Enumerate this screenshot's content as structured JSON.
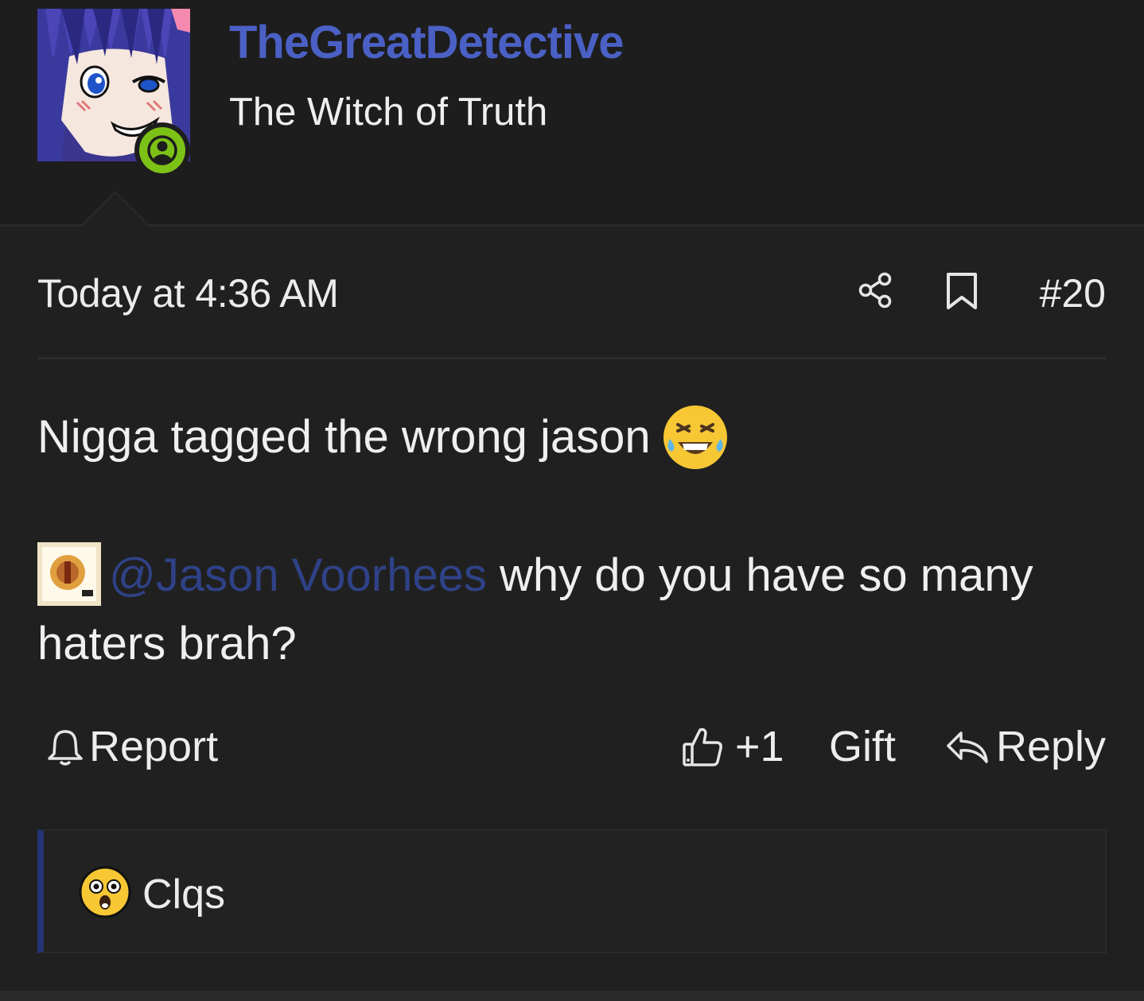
{
  "post": {
    "author": {
      "username": "TheGreatDetective",
      "title": "The Witch of Truth",
      "avatar_icon": "anime-avatar",
      "status_icon": "online-user-icon",
      "username_color": "#4a60c4",
      "status_color": "#7cc116"
    },
    "date": "Today at 4:36 AM",
    "number": "#20",
    "body": {
      "line1_text": "Nigga tagged the wrong jason",
      "line1_emoji": "crying-laughing-emoji",
      "mention": "@Jason Voorhees",
      "mention_avatar": "album-cover-avatar",
      "line2_text": " why do you have so many haters brah?"
    },
    "actions": {
      "report_label": "Report",
      "like_label": "+1",
      "gift_label": "Gift",
      "reply_label": "Reply"
    },
    "reactions": {
      "emoji": "astonished-face-emoji",
      "user": "Clqs"
    }
  },
  "colors": {
    "background": "#202020",
    "mention": "#2f4288",
    "reaction_accent": "#253573"
  }
}
